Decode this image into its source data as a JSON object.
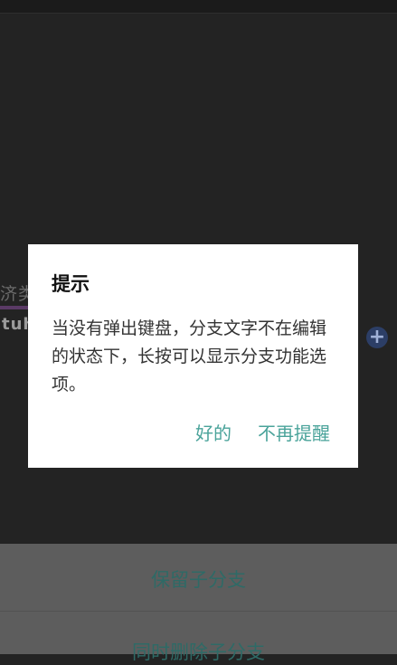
{
  "background": {
    "fragment_text": "济类",
    "watermark": "tuhuab.com"
  },
  "dialog": {
    "title": "提示",
    "message": "当没有弹出键盘，分支文字不在编辑的状态下，长按可以显示分支功能选项。",
    "ok_label": "好的",
    "never_remind_label": "不再提醒"
  },
  "sheet": {
    "items": [
      {
        "label": "保留子分支"
      },
      {
        "label": "同时删除子分支"
      }
    ]
  },
  "colors": {
    "accent": "#4aa39a",
    "sheet_text": "#2e6a66",
    "backdrop": "#232323"
  }
}
